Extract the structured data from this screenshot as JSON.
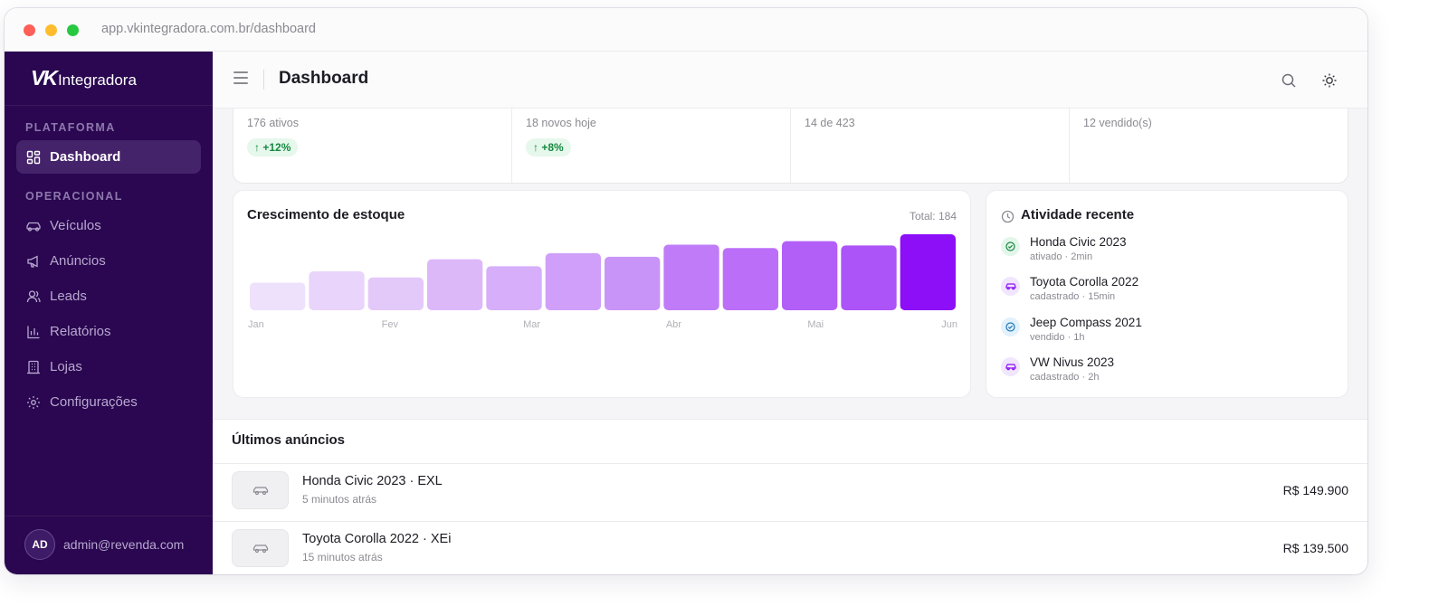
{
  "browser": {
    "url": "app.vkintegradora.com.br/dashboard"
  },
  "sidebar": {
    "logo": {
      "mark": "VK",
      "name": "Integradora"
    },
    "sections": [
      {
        "label": "PLATAFORMA"
      },
      {
        "label": "OPERACIONAL"
      }
    ],
    "items": [
      {
        "label": "Dashboard",
        "icon": "dashboard-grid-icon",
        "active": true
      },
      {
        "label": "Veículos",
        "icon": "car-icon"
      },
      {
        "label": "Anúncios",
        "icon": "megaphone-icon"
      },
      {
        "label": "Leads",
        "icon": "users-icon"
      },
      {
        "label": "Relatórios",
        "icon": "bar-chart-icon"
      },
      {
        "label": "Lojas",
        "icon": "building-icon"
      },
      {
        "label": "Configurações",
        "icon": "gear-icon"
      }
    ],
    "user": {
      "initials": "AD",
      "email": "admin@revenda.com"
    }
  },
  "header": {
    "title": "Dashboard",
    "icons": [
      "search-icon",
      "sun-icon"
    ]
  },
  "stats": [
    {
      "subtext": "176 ativos",
      "badge": "↑ +12%"
    },
    {
      "subtext": "18 novos hoje",
      "badge": "↑ +8%"
    },
    {
      "subtext": "14 de 423"
    },
    {
      "subtext": "12 vendido(s)"
    }
  ],
  "chart_card": {
    "title": "Crescimento de estoque",
    "total": "Total: 184"
  },
  "chart_data": {
    "type": "bar",
    "title": "Crescimento de estoque",
    "x_tick_labels": [
      "Jan",
      "Fev",
      "Mar",
      "Abr",
      "Mai",
      "Jun"
    ],
    "values": [
      32,
      45,
      38,
      59,
      51,
      66,
      62,
      76,
      72,
      80,
      75,
      88
    ],
    "ylim": [
      0,
      88
    ],
    "colors": [
      "#eee1fb",
      "#e9d4fb",
      "#e3c8fa",
      "#dcb8f9",
      "#d6aefa",
      "#cf9ff9",
      "#c994f8",
      "#c07cf8",
      "#bb6ff8",
      "#b25ff8",
      "#ac54f8",
      "#8d0ff7"
    ],
    "grid": false,
    "legend": "none"
  },
  "activity": {
    "title": "Atividade recente",
    "items": [
      {
        "name": "Honda Civic 2023",
        "meta": "ativado · 2min",
        "icon": "check-circle-icon",
        "tone": "green"
      },
      {
        "name": "Toyota Corolla 2022",
        "meta": "cadastrado · 15min",
        "icon": "car-icon",
        "tone": "purple"
      },
      {
        "name": "Jeep Compass 2021",
        "meta": "vendido · 1h",
        "icon": "check-circle-icon",
        "tone": "blue"
      },
      {
        "name": "VW Nivus 2023",
        "meta": "cadastrado · 2h",
        "icon": "car-icon",
        "tone": "purple"
      }
    ]
  },
  "listings": {
    "title": "Últimos anúncios",
    "rows": [
      {
        "title": "Honda Civic 2023 · EXL",
        "time": "5 minutos atrás",
        "price": "R$ 149.900"
      },
      {
        "title": "Toyota Corolla 2022 · XEi",
        "time": "15 minutos atrás",
        "price": "R$ 139.500"
      }
    ]
  },
  "colors": {
    "sidebar": "#2a0750",
    "accent": "#8d0ff7",
    "success": "#15893f"
  }
}
